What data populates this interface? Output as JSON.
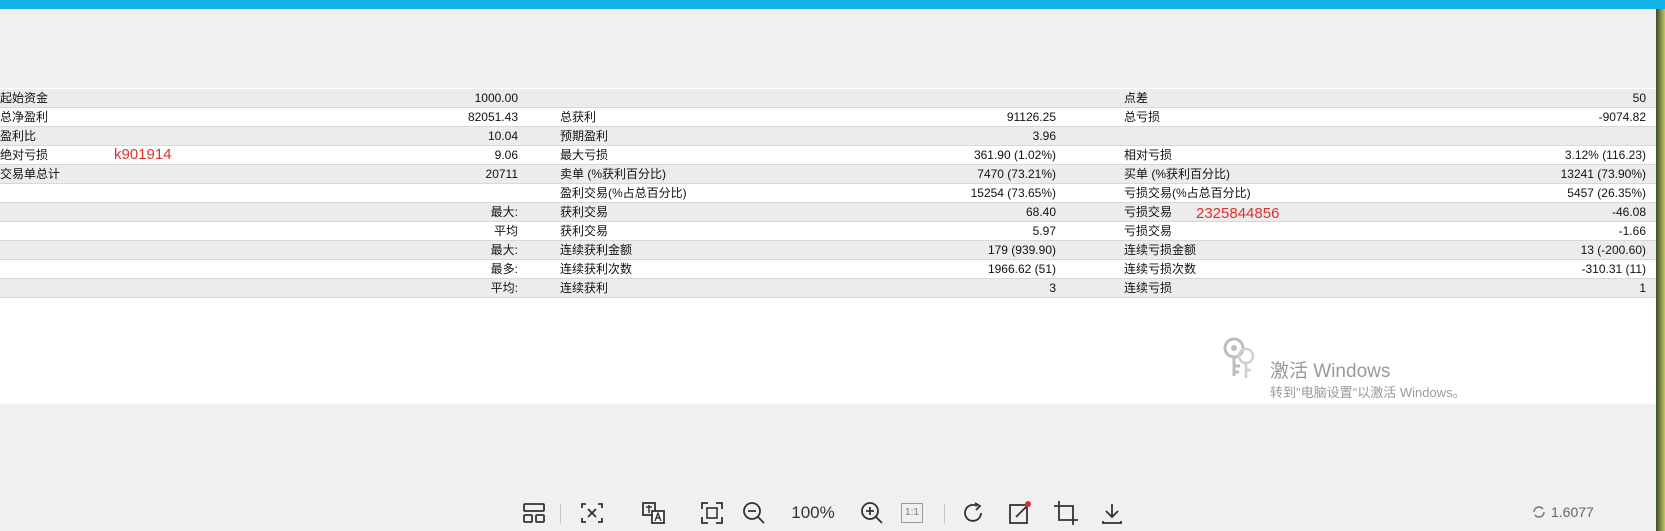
{
  "report": {
    "rows": [
      {
        "c1": "起始资金",
        "c2": "1000.00",
        "c3": "",
        "c4": "",
        "c5": "点差",
        "c6": "50",
        "alt": true
      },
      {
        "c1": "总净盈利",
        "c2": "82051.43",
        "c3": "总获利",
        "c4": "91126.25",
        "c5": "总亏损",
        "c6": "-9074.82",
        "alt": false
      },
      {
        "c1": "盈利比",
        "c2": "10.04",
        "c3": "预期盈利",
        "c4": "3.96",
        "c5": "",
        "c6": "",
        "alt": true
      },
      {
        "c1": "绝对亏损",
        "c2": "9.06",
        "c3": "最大亏损",
        "c4": "361.90 (1.02%)",
        "c5": "相对亏损",
        "c6": "3.12% (116.23)",
        "alt": false
      },
      {
        "c1": "交易单总计",
        "c2": "20711",
        "c3": "卖单 (%获利百分比)",
        "c4": "7470 (73.21%)",
        "c5": "买单 (%获利百分比)",
        "c6": "13241 (73.90%)",
        "alt": true
      },
      {
        "c1": "",
        "c2": "",
        "c3": "盈利交易(%占总百分比)",
        "c4": "15254 (73.65%)",
        "c5": "亏损交易(%占总百分比)",
        "c6": "5457 (26.35%)",
        "alt": false
      },
      {
        "c1": "",
        "c2": "最大:",
        "c3": "获利交易",
        "c4": "68.40",
        "c5": "亏损交易",
        "c6": "-46.08",
        "alt": true
      },
      {
        "c1": "",
        "c2": "平均",
        "c3": "获利交易",
        "c4": "5.97",
        "c5": "亏损交易",
        "c6": "-1.66",
        "alt": false
      },
      {
        "c1": "",
        "c2": "最大:",
        "c3": "连续获利金额",
        "c4": "179 (939.90)",
        "c5": "连续亏损金额",
        "c6": "13 (-200.60)",
        "alt": true
      },
      {
        "c1": "",
        "c2": "最多:",
        "c3": "连续获利次数",
        "c4": "1966.62 (51)",
        "c5": "连续亏损次数",
        "c6": "-310.31 (11)",
        "alt": false
      },
      {
        "c1": "",
        "c2": "平均:",
        "c3": "连续获利",
        "c4": "3",
        "c5": "连续亏损",
        "c6": "1",
        "alt": true
      }
    ]
  },
  "annotations": {
    "left_text": "k901914",
    "right_text": "2325844856",
    "color": "#e0302e"
  },
  "watermark": {
    "title": "激活 Windows",
    "subtitle": "转到\"电脑设置\"以激活 Windows。"
  },
  "toolbar": {
    "zoom_label": "100%",
    "actual_size_label": "1:1",
    "counter_label": "1.6077"
  },
  "colors": {
    "topbar": "#13b2e8",
    "row_alt": "#ececec"
  }
}
